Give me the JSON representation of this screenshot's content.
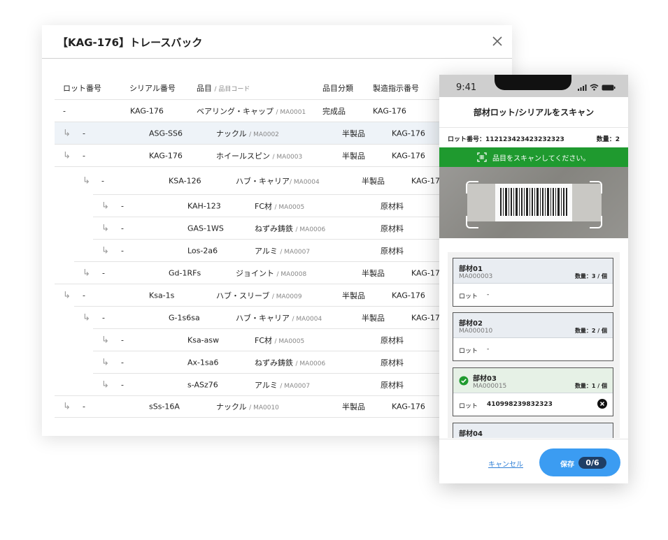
{
  "dialog": {
    "title": "【KAG-176】トレースバック",
    "columns": {
      "lot": "ロット番号",
      "serial": "シリアル番号",
      "item": "品目",
      "item_code": "/ 品目コード",
      "category": "品目分類",
      "order": "製造指示番号"
    },
    "rows": [
      {
        "lot": "-",
        "serial": "KAG-176",
        "item": "ベアリング・キャップ",
        "code": "/ MA0001",
        "category": "完成品",
        "order": "KAG-176"
      },
      {
        "lot": "-",
        "serial": "ASG-SS6",
        "item": "ナックル",
        "code": "/ MA0002",
        "category": "半製品",
        "order": "KAG-176"
      },
      {
        "lot": "-",
        "serial": "KAG-176",
        "item": "ホイールスピン",
        "code": "/ MA0003",
        "category": "半製品",
        "order": "KAG-176"
      },
      {
        "lot": "-",
        "serial": "KSA-126",
        "item": "ハブ・キャリア",
        "code": "/ MA0004",
        "category": "半製品",
        "order": "KAG-176"
      },
      {
        "lot": "-",
        "serial": "KAH-123",
        "item": "FC材",
        "code": "/ MA0005",
        "category": "原材料",
        "order": ""
      },
      {
        "lot": "-",
        "serial": "GAS-1WS",
        "item": "ねずみ鋳鉄",
        "code": "/ MA0006",
        "category": "原材料",
        "order": ""
      },
      {
        "lot": "-",
        "serial": "Los-2a6",
        "item": "アルミ",
        "code": "/ MA0007",
        "category": "原材料",
        "order": ""
      },
      {
        "lot": "-",
        "serial": "Gd-1RFs",
        "item": "ジョイント",
        "code": "/ MA0008",
        "category": "半製品",
        "order": "KAG-176"
      },
      {
        "lot": "-",
        "serial": "Ksa-1s",
        "item": "ハブ・スリーブ",
        "code": "/ MA0009",
        "category": "半製品",
        "order": "KAG-176"
      },
      {
        "lot": "-",
        "serial": "G-1s6sa",
        "item": "ハブ・キャリア",
        "code": "/ MA0004",
        "category": "半製品",
        "order": "KAG-176"
      },
      {
        "lot": "-",
        "serial": "Ksa-asw",
        "item": "FC材",
        "code": "/ MA0005",
        "category": "原材料",
        "order": ""
      },
      {
        "lot": "-",
        "serial": "Ax-1sa6",
        "item": "ねずみ鋳鉄",
        "code": "/ MA0006",
        "category": "原材料",
        "order": ""
      },
      {
        "lot": "-",
        "serial": "s-ASz76",
        "item": "アルミ",
        "code": "/ MA0007",
        "category": "原材料",
        "order": ""
      },
      {
        "lot": "-",
        "serial": "sSs-16A",
        "item": "ナックル",
        "code": "/ MA0010",
        "category": "半製品",
        "order": "KAG-176"
      }
    ]
  },
  "phone": {
    "time": "9:41",
    "title": "部材ロット/シリアルをスキャン",
    "lot_label": "ロット番号：112123423423232323",
    "qty_label": "数量：2",
    "banner": "品目をスキャンしてください。",
    "cards": [
      {
        "name": "部材01",
        "code": "MA000003",
        "qty": "数量：3 / 個",
        "lot_label": "ロット",
        "lot_value": "-"
      },
      {
        "name": "部材02",
        "code": "MA000010",
        "qty": "数量：2 / 個",
        "lot_label": "ロット",
        "lot_value": "-"
      },
      {
        "name": "部材03",
        "code": "MA000015",
        "qty": "数量：1 / 個",
        "lot_label": "ロット",
        "lot_value": "410998239832323"
      },
      {
        "name": "部材04",
        "code": "",
        "qty": "",
        "lot_label": "",
        "lot_value": ""
      }
    ],
    "cancel": "キャンセル",
    "save": "保存",
    "save_count": "0/6"
  },
  "colors": {
    "accent": "#3b9cf2",
    "banner": "#1f9a2f",
    "highlight_row": "#eef3f8"
  }
}
